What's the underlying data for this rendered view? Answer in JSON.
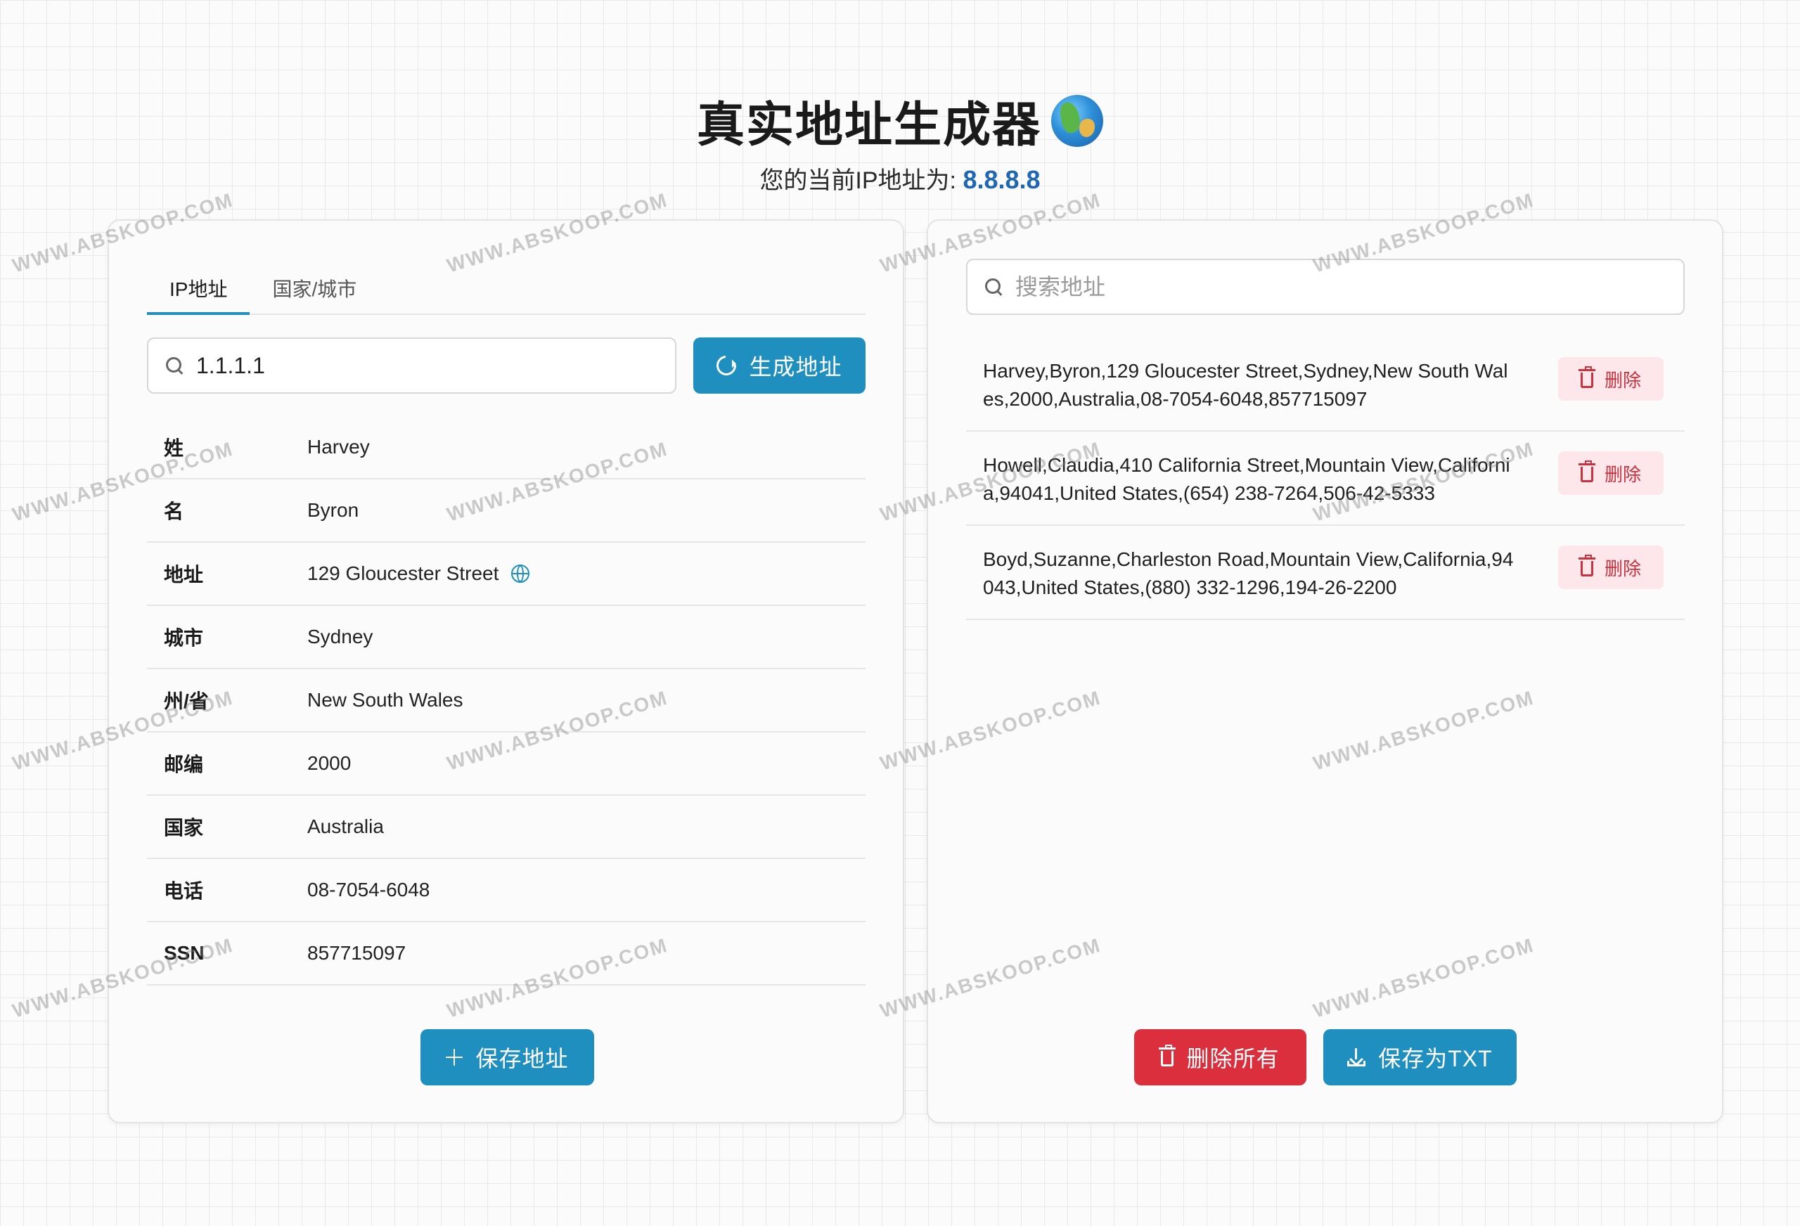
{
  "header": {
    "title": "真实地址生成器",
    "subtitle_prefix": "您的当前IP地址为: ",
    "current_ip": "8.8.8.8"
  },
  "left_panel": {
    "tabs": [
      {
        "label": "IP地址",
        "active": true
      },
      {
        "label": "国家/城市",
        "active": false
      }
    ],
    "search": {
      "value": "1.1.1.1",
      "placeholder": ""
    },
    "generate_label": "生成地址",
    "rows": [
      {
        "label": "姓",
        "value": "Harvey"
      },
      {
        "label": "名",
        "value": "Byron"
      },
      {
        "label": "地址",
        "value": "129 Gloucester Street"
      },
      {
        "label": "城市",
        "value": "Sydney"
      },
      {
        "label": "州/省",
        "value": "New South Wales"
      },
      {
        "label": "邮编",
        "value": "2000"
      },
      {
        "label": "国家",
        "value": "Australia"
      },
      {
        "label": "电话",
        "value": "08-7054-6048"
      },
      {
        "label": "SSN",
        "value": "857715097"
      }
    ],
    "save_label": "保存地址"
  },
  "right_panel": {
    "search_placeholder": "搜索地址",
    "delete_label": "删除",
    "items": [
      {
        "text": "Harvey,Byron,129 Gloucester Street,Sydney,New South Wales,2000,Australia,08-7054-6048,857715097"
      },
      {
        "text": "Howell,Claudia,410 California Street,Mountain View,California,94041,United States,(654) 238-7264,506-42-5333"
      },
      {
        "text": "Boyd,Suzanne,Charleston Road,Mountain View,California,94043,United States,(880) 332-1296,194-26-2200"
      }
    ],
    "delete_all_label": "删除所有",
    "save_txt_label": "保存为TXT"
  },
  "watermark": "WWW.ABSKOOP.COM",
  "colors": {
    "primary": "#1f8fbf",
    "danger": "#dc2f3d",
    "ip_highlight": "#1f67b3"
  }
}
